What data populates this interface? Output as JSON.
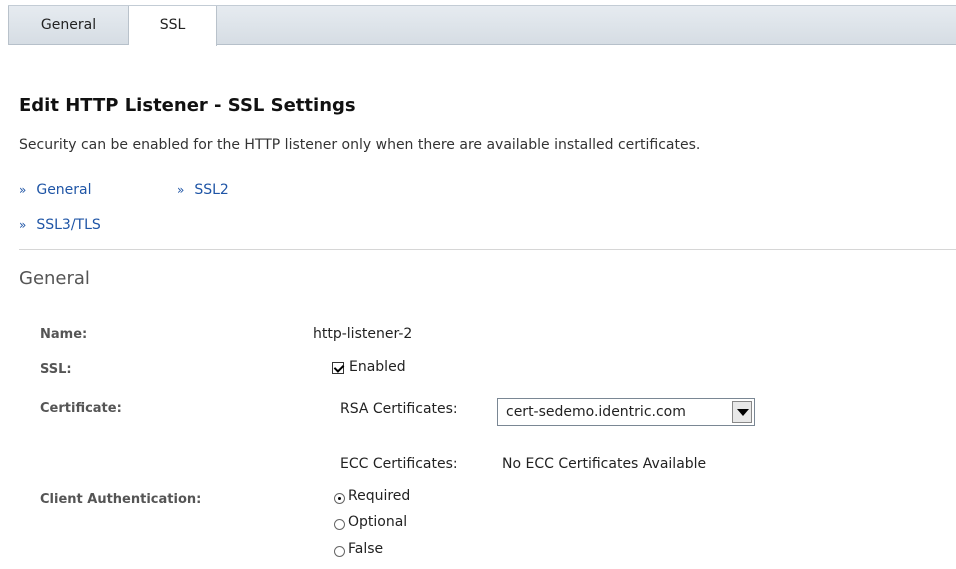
{
  "tabs": [
    {
      "label": "General",
      "selected": false
    },
    {
      "label": "SSL",
      "selected": true
    }
  ],
  "page_title": "Edit HTTP Listener - SSL Settings",
  "help_text": "Security can be enabled for the HTTP listener only when there are available installed certificates.",
  "jump_links": [
    {
      "icon": "double-chevron-down-icon",
      "label": "General"
    },
    {
      "icon": "double-chevron-down-icon",
      "label": "SSL2"
    },
    {
      "icon": "double-chevron-down-icon",
      "label": "SSL3/TLS"
    }
  ],
  "section": {
    "title": "General",
    "name_label": "Name:",
    "name_value": "http-listener-2",
    "ssl_label": "SSL:",
    "ssl_enabled_label": "Enabled",
    "ssl_enabled": true,
    "certificate_label": "Certificate:",
    "rsa_label": "RSA Certificates:",
    "rsa_selected": "cert-sedemo.identric.com",
    "ecc_label": "ECC Certificates:",
    "ecc_value": "No ECC Certificates Available",
    "client_auth_label": "Client Authentication:",
    "client_auth_options": [
      "Required",
      "Optional",
      "False"
    ],
    "client_auth_selected": "Required"
  },
  "colors": {
    "link": "#1f55a6",
    "tabbar": "#d6dde4",
    "label": "#555555"
  }
}
